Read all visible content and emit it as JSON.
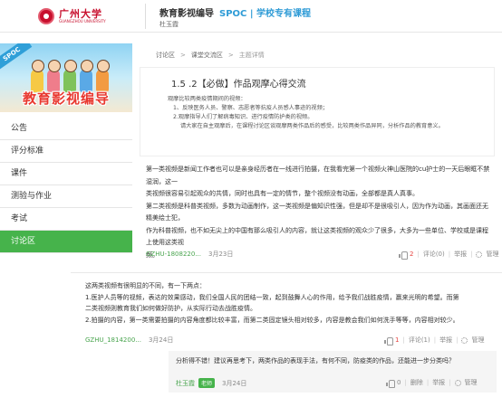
{
  "header": {
    "logo_cn": "广州大学",
    "logo_en": "GUANGZHOU UNIVERSITY",
    "course_name": "教育影视编导",
    "spoc": "SPOC | 学校专有课程",
    "teacher": "杜玉霞"
  },
  "sidebar": {
    "banner_spoc": "SPOC",
    "banner_title": "教育影视编导",
    "items": [
      {
        "label": "公告"
      },
      {
        "label": "评分标准"
      },
      {
        "label": "课件"
      },
      {
        "label": "测验与作业"
      },
      {
        "label": "考试"
      },
      {
        "label": "讨论区"
      }
    ]
  },
  "breadcrumb": {
    "item1": "讨论区",
    "item2": "课堂交流区",
    "current": "主题详情",
    "sep": ">"
  },
  "topic": {
    "title": "1.5 .2【必做】作品观摩心得交流",
    "lines": [
      "观摩比较两类疫情期间的视频：",
      "1、反映医务人员、警察、志愿者等抗疫人员感人事迹的视频；",
      "2.观摩指导人们了解病毒知识、进行疫情防护类的视频。",
      "请大家在自主观摩后，在课程讨论区谈观摩两类作品后的感受，比较两类作品异同，分析作品的教育意义。"
    ]
  },
  "post1": {
    "lines": [
      "第一类视频是新闻工作者也可以是亲身经历者在一线进行拍摄，在我看完第一个视频火神山医院的cu护士的一天后眼眶不禁湿润，这一",
      "类视频很容易引起观众的共情，同时也具有一定的情节，整个视频没有动画，全部都是真人真事。",
      "第二类视频是科普类视频，多数为动画制作，这一类视频是偏知识性强，但是却不是很吸引人，因为作为动画，其画面还无精美绘士犯，",
      "作为科普视频，也不如无尖上的中国有那么吸引人的内容，就让这类视频的观众少了很多，大多为一些单位、学校或是课程上使用这类视",
      "频。"
    ],
    "user": "GZHU-1808220...",
    "date": "3月23日",
    "likes": "2",
    "comment": "评论(0)",
    "report": "举报",
    "manage": "管理"
  },
  "post2": {
    "lines": [
      "这两类视频有很明显的不同，有一下两点：",
      "1.医护人员等的视频，表达的效果感动，我们全国人民的团结一致，起到鼓舞人心的作用，给予我们战胜疫情，赢来光明的希望。而第",
      "二类视频则教育我们如何做好防护，从实际行动去战胜疫情。",
      "2.拍摄的内容，第一类需要拍摄的内容角度都比较丰富，而第二类固定镜头相对较多，内容是教会我们如何洗手等等，内容相对较少。"
    ],
    "user": "GZHU_1814200...",
    "date": "3月24日",
    "likes": "1",
    "comment": "评论(1)",
    "report": "举报",
    "manage": "管理"
  },
  "reply": {
    "text": "分析得不错！建议再思考下，两类作品的表现手法，有何不同，防疫类的作品，还能进一步分类吗？",
    "user": "杜玉霞",
    "badge": "老师",
    "date": "3月24日",
    "likes": "0",
    "delete": "删除",
    "report": "举报",
    "manage": "管理"
  },
  "colors": {
    "brand_red": "#c8102e",
    "accent_green": "#46b34b",
    "spoc_blue": "#2e9bd6",
    "banner_title": "#e8382f"
  }
}
